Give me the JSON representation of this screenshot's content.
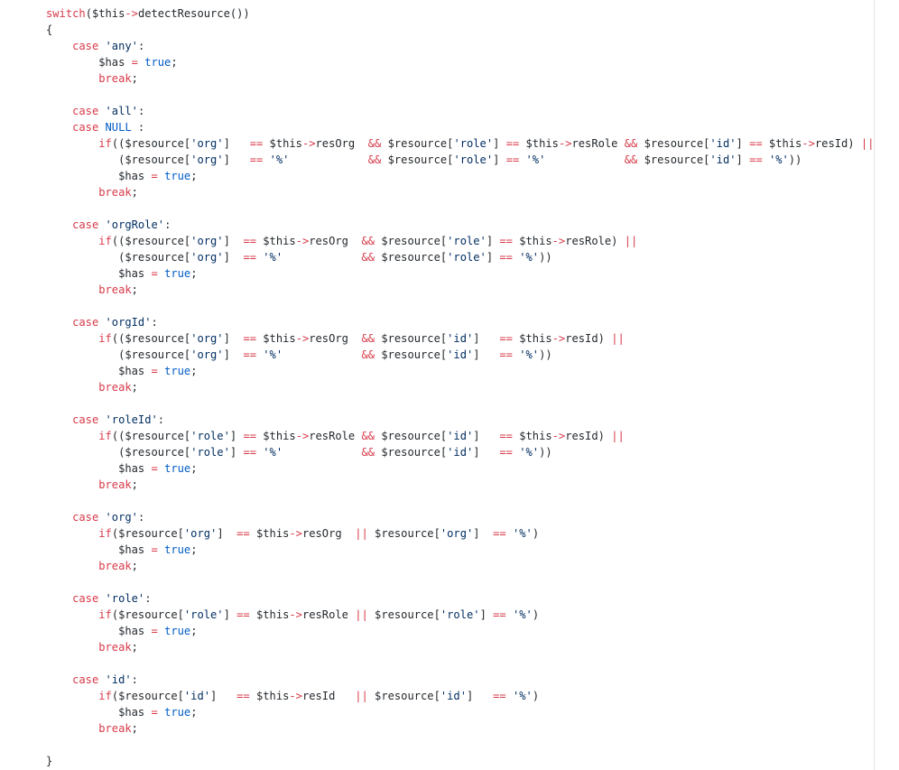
{
  "code_lines": [
    [
      {
        "t": "switch",
        "c": "k"
      },
      {
        "t": "($this",
        "c": "p"
      },
      {
        "t": "->",
        "c": "k"
      },
      {
        "t": "detectResource())",
        "c": "p"
      }
    ],
    [
      {
        "t": "{",
        "c": "p"
      }
    ],
    [
      {
        "t": "    ",
        "c": "p"
      },
      {
        "t": "case",
        "c": "k"
      },
      {
        "t": " ",
        "c": "p"
      },
      {
        "t": "'any'",
        "c": "s"
      },
      {
        "t": ":",
        "c": "p"
      }
    ],
    [
      {
        "t": "        $has ",
        "c": "p"
      },
      {
        "t": "=",
        "c": "k"
      },
      {
        "t": " ",
        "c": "p"
      },
      {
        "t": "true",
        "c": "c"
      },
      {
        "t": ";",
        "c": "p"
      }
    ],
    [
      {
        "t": "        ",
        "c": "p"
      },
      {
        "t": "break",
        "c": "k"
      },
      {
        "t": ";",
        "c": "p"
      }
    ],
    [],
    [
      {
        "t": "    ",
        "c": "p"
      },
      {
        "t": "case",
        "c": "k"
      },
      {
        "t": " ",
        "c": "p"
      },
      {
        "t": "'all'",
        "c": "s"
      },
      {
        "t": ":",
        "c": "p"
      }
    ],
    [
      {
        "t": "    ",
        "c": "p"
      },
      {
        "t": "case",
        "c": "k"
      },
      {
        "t": " ",
        "c": "p"
      },
      {
        "t": "NULL",
        "c": "c"
      },
      {
        "t": " :",
        "c": "p"
      }
    ],
    [
      {
        "t": "        ",
        "c": "p"
      },
      {
        "t": "if",
        "c": "k"
      },
      {
        "t": "(($resource[",
        "c": "p"
      },
      {
        "t": "'org'",
        "c": "s"
      },
      {
        "t": "]   ",
        "c": "p"
      },
      {
        "t": "==",
        "c": "k"
      },
      {
        "t": " $this",
        "c": "p"
      },
      {
        "t": "->",
        "c": "k"
      },
      {
        "t": "resOrg  ",
        "c": "p"
      },
      {
        "t": "&&",
        "c": "k"
      },
      {
        "t": " $resource[",
        "c": "p"
      },
      {
        "t": "'role'",
        "c": "s"
      },
      {
        "t": "] ",
        "c": "p"
      },
      {
        "t": "==",
        "c": "k"
      },
      {
        "t": " $this",
        "c": "p"
      },
      {
        "t": "->",
        "c": "k"
      },
      {
        "t": "resRole ",
        "c": "p"
      },
      {
        "t": "&&",
        "c": "k"
      },
      {
        "t": " $resource[",
        "c": "p"
      },
      {
        "t": "'id'",
        "c": "s"
      },
      {
        "t": "] ",
        "c": "p"
      },
      {
        "t": "==",
        "c": "k"
      },
      {
        "t": " $this",
        "c": "p"
      },
      {
        "t": "->",
        "c": "k"
      },
      {
        "t": "resId) ",
        "c": "p"
      },
      {
        "t": "||",
        "c": "k"
      }
    ],
    [
      {
        "t": "           ($resource[",
        "c": "p"
      },
      {
        "t": "'org'",
        "c": "s"
      },
      {
        "t": "]   ",
        "c": "p"
      },
      {
        "t": "==",
        "c": "k"
      },
      {
        "t": " ",
        "c": "p"
      },
      {
        "t": "'%'",
        "c": "s"
      },
      {
        "t": "            ",
        "c": "p"
      },
      {
        "t": "&&",
        "c": "k"
      },
      {
        "t": " $resource[",
        "c": "p"
      },
      {
        "t": "'role'",
        "c": "s"
      },
      {
        "t": "] ",
        "c": "p"
      },
      {
        "t": "==",
        "c": "k"
      },
      {
        "t": " ",
        "c": "p"
      },
      {
        "t": "'%'",
        "c": "s"
      },
      {
        "t": "            ",
        "c": "p"
      },
      {
        "t": "&&",
        "c": "k"
      },
      {
        "t": " $resource[",
        "c": "p"
      },
      {
        "t": "'id'",
        "c": "s"
      },
      {
        "t": "] ",
        "c": "p"
      },
      {
        "t": "==",
        "c": "k"
      },
      {
        "t": " ",
        "c": "p"
      },
      {
        "t": "'%'",
        "c": "s"
      },
      {
        "t": "))",
        "c": "p"
      }
    ],
    [
      {
        "t": "           $has ",
        "c": "p"
      },
      {
        "t": "=",
        "c": "k"
      },
      {
        "t": " ",
        "c": "p"
      },
      {
        "t": "true",
        "c": "c"
      },
      {
        "t": ";",
        "c": "p"
      }
    ],
    [
      {
        "t": "        ",
        "c": "p"
      },
      {
        "t": "break",
        "c": "k"
      },
      {
        "t": ";",
        "c": "p"
      }
    ],
    [],
    [
      {
        "t": "    ",
        "c": "p"
      },
      {
        "t": "case",
        "c": "k"
      },
      {
        "t": " ",
        "c": "p"
      },
      {
        "t": "'orgRole'",
        "c": "s"
      },
      {
        "t": ":",
        "c": "p"
      }
    ],
    [
      {
        "t": "        ",
        "c": "p"
      },
      {
        "t": "if",
        "c": "k"
      },
      {
        "t": "(($resource[",
        "c": "p"
      },
      {
        "t": "'org'",
        "c": "s"
      },
      {
        "t": "]  ",
        "c": "p"
      },
      {
        "t": "==",
        "c": "k"
      },
      {
        "t": " $this",
        "c": "p"
      },
      {
        "t": "->",
        "c": "k"
      },
      {
        "t": "resOrg  ",
        "c": "p"
      },
      {
        "t": "&&",
        "c": "k"
      },
      {
        "t": " $resource[",
        "c": "p"
      },
      {
        "t": "'role'",
        "c": "s"
      },
      {
        "t": "] ",
        "c": "p"
      },
      {
        "t": "==",
        "c": "k"
      },
      {
        "t": " $this",
        "c": "p"
      },
      {
        "t": "->",
        "c": "k"
      },
      {
        "t": "resRole) ",
        "c": "p"
      },
      {
        "t": "||",
        "c": "k"
      }
    ],
    [
      {
        "t": "           ($resource[",
        "c": "p"
      },
      {
        "t": "'org'",
        "c": "s"
      },
      {
        "t": "]  ",
        "c": "p"
      },
      {
        "t": "==",
        "c": "k"
      },
      {
        "t": " ",
        "c": "p"
      },
      {
        "t": "'%'",
        "c": "s"
      },
      {
        "t": "            ",
        "c": "p"
      },
      {
        "t": "&&",
        "c": "k"
      },
      {
        "t": " $resource[",
        "c": "p"
      },
      {
        "t": "'role'",
        "c": "s"
      },
      {
        "t": "] ",
        "c": "p"
      },
      {
        "t": "==",
        "c": "k"
      },
      {
        "t": " ",
        "c": "p"
      },
      {
        "t": "'%'",
        "c": "s"
      },
      {
        "t": "))",
        "c": "p"
      }
    ],
    [
      {
        "t": "           $has ",
        "c": "p"
      },
      {
        "t": "=",
        "c": "k"
      },
      {
        "t": " ",
        "c": "p"
      },
      {
        "t": "true",
        "c": "c"
      },
      {
        "t": ";",
        "c": "p"
      }
    ],
    [
      {
        "t": "        ",
        "c": "p"
      },
      {
        "t": "break",
        "c": "k"
      },
      {
        "t": ";",
        "c": "p"
      }
    ],
    [],
    [
      {
        "t": "    ",
        "c": "p"
      },
      {
        "t": "case",
        "c": "k"
      },
      {
        "t": " ",
        "c": "p"
      },
      {
        "t": "'orgId'",
        "c": "s"
      },
      {
        "t": ":",
        "c": "p"
      }
    ],
    [
      {
        "t": "        ",
        "c": "p"
      },
      {
        "t": "if",
        "c": "k"
      },
      {
        "t": "(($resource[",
        "c": "p"
      },
      {
        "t": "'org'",
        "c": "s"
      },
      {
        "t": "]  ",
        "c": "p"
      },
      {
        "t": "==",
        "c": "k"
      },
      {
        "t": " $this",
        "c": "p"
      },
      {
        "t": "->",
        "c": "k"
      },
      {
        "t": "resOrg  ",
        "c": "p"
      },
      {
        "t": "&&",
        "c": "k"
      },
      {
        "t": " $resource[",
        "c": "p"
      },
      {
        "t": "'id'",
        "c": "s"
      },
      {
        "t": "]   ",
        "c": "p"
      },
      {
        "t": "==",
        "c": "k"
      },
      {
        "t": " $this",
        "c": "p"
      },
      {
        "t": "->",
        "c": "k"
      },
      {
        "t": "resId) ",
        "c": "p"
      },
      {
        "t": "||",
        "c": "k"
      }
    ],
    [
      {
        "t": "           ($resource[",
        "c": "p"
      },
      {
        "t": "'org'",
        "c": "s"
      },
      {
        "t": "]  ",
        "c": "p"
      },
      {
        "t": "==",
        "c": "k"
      },
      {
        "t": " ",
        "c": "p"
      },
      {
        "t": "'%'",
        "c": "s"
      },
      {
        "t": "            ",
        "c": "p"
      },
      {
        "t": "&&",
        "c": "k"
      },
      {
        "t": " $resource[",
        "c": "p"
      },
      {
        "t": "'id'",
        "c": "s"
      },
      {
        "t": "]   ",
        "c": "p"
      },
      {
        "t": "==",
        "c": "k"
      },
      {
        "t": " ",
        "c": "p"
      },
      {
        "t": "'%'",
        "c": "s"
      },
      {
        "t": "))",
        "c": "p"
      }
    ],
    [
      {
        "t": "           $has ",
        "c": "p"
      },
      {
        "t": "=",
        "c": "k"
      },
      {
        "t": " ",
        "c": "p"
      },
      {
        "t": "true",
        "c": "c"
      },
      {
        "t": ";",
        "c": "p"
      }
    ],
    [
      {
        "t": "        ",
        "c": "p"
      },
      {
        "t": "break",
        "c": "k"
      },
      {
        "t": ";",
        "c": "p"
      }
    ],
    [],
    [
      {
        "t": "    ",
        "c": "p"
      },
      {
        "t": "case",
        "c": "k"
      },
      {
        "t": " ",
        "c": "p"
      },
      {
        "t": "'roleId'",
        "c": "s"
      },
      {
        "t": ":",
        "c": "p"
      }
    ],
    [
      {
        "t": "        ",
        "c": "p"
      },
      {
        "t": "if",
        "c": "k"
      },
      {
        "t": "(($resource[",
        "c": "p"
      },
      {
        "t": "'role'",
        "c": "s"
      },
      {
        "t": "] ",
        "c": "p"
      },
      {
        "t": "==",
        "c": "k"
      },
      {
        "t": " $this",
        "c": "p"
      },
      {
        "t": "->",
        "c": "k"
      },
      {
        "t": "resRole ",
        "c": "p"
      },
      {
        "t": "&&",
        "c": "k"
      },
      {
        "t": " $resource[",
        "c": "p"
      },
      {
        "t": "'id'",
        "c": "s"
      },
      {
        "t": "]   ",
        "c": "p"
      },
      {
        "t": "==",
        "c": "k"
      },
      {
        "t": " $this",
        "c": "p"
      },
      {
        "t": "->",
        "c": "k"
      },
      {
        "t": "resId) ",
        "c": "p"
      },
      {
        "t": "||",
        "c": "k"
      }
    ],
    [
      {
        "t": "           ($resource[",
        "c": "p"
      },
      {
        "t": "'role'",
        "c": "s"
      },
      {
        "t": "] ",
        "c": "p"
      },
      {
        "t": "==",
        "c": "k"
      },
      {
        "t": " ",
        "c": "p"
      },
      {
        "t": "'%'",
        "c": "s"
      },
      {
        "t": "            ",
        "c": "p"
      },
      {
        "t": "&&",
        "c": "k"
      },
      {
        "t": " $resource[",
        "c": "p"
      },
      {
        "t": "'id'",
        "c": "s"
      },
      {
        "t": "]   ",
        "c": "p"
      },
      {
        "t": "==",
        "c": "k"
      },
      {
        "t": " ",
        "c": "p"
      },
      {
        "t": "'%'",
        "c": "s"
      },
      {
        "t": "))",
        "c": "p"
      }
    ],
    [
      {
        "t": "           $has ",
        "c": "p"
      },
      {
        "t": "=",
        "c": "k"
      },
      {
        "t": " ",
        "c": "p"
      },
      {
        "t": "true",
        "c": "c"
      },
      {
        "t": ";",
        "c": "p"
      }
    ],
    [
      {
        "t": "        ",
        "c": "p"
      },
      {
        "t": "break",
        "c": "k"
      },
      {
        "t": ";",
        "c": "p"
      }
    ],
    [],
    [
      {
        "t": "    ",
        "c": "p"
      },
      {
        "t": "case",
        "c": "k"
      },
      {
        "t": " ",
        "c": "p"
      },
      {
        "t": "'org'",
        "c": "s"
      },
      {
        "t": ":",
        "c": "p"
      }
    ],
    [
      {
        "t": "        ",
        "c": "p"
      },
      {
        "t": "if",
        "c": "k"
      },
      {
        "t": "($resource[",
        "c": "p"
      },
      {
        "t": "'org'",
        "c": "s"
      },
      {
        "t": "]  ",
        "c": "p"
      },
      {
        "t": "==",
        "c": "k"
      },
      {
        "t": " $this",
        "c": "p"
      },
      {
        "t": "->",
        "c": "k"
      },
      {
        "t": "resOrg  ",
        "c": "p"
      },
      {
        "t": "||",
        "c": "k"
      },
      {
        "t": " $resource[",
        "c": "p"
      },
      {
        "t": "'org'",
        "c": "s"
      },
      {
        "t": "]  ",
        "c": "p"
      },
      {
        "t": "==",
        "c": "k"
      },
      {
        "t": " ",
        "c": "p"
      },
      {
        "t": "'%'",
        "c": "s"
      },
      {
        "t": ")",
        "c": "p"
      }
    ],
    [
      {
        "t": "           $has ",
        "c": "p"
      },
      {
        "t": "=",
        "c": "k"
      },
      {
        "t": " ",
        "c": "p"
      },
      {
        "t": "true",
        "c": "c"
      },
      {
        "t": ";",
        "c": "p"
      }
    ],
    [
      {
        "t": "        ",
        "c": "p"
      },
      {
        "t": "break",
        "c": "k"
      },
      {
        "t": ";",
        "c": "p"
      }
    ],
    [],
    [
      {
        "t": "    ",
        "c": "p"
      },
      {
        "t": "case",
        "c": "k"
      },
      {
        "t": " ",
        "c": "p"
      },
      {
        "t": "'role'",
        "c": "s"
      },
      {
        "t": ":",
        "c": "p"
      }
    ],
    [
      {
        "t": "        ",
        "c": "p"
      },
      {
        "t": "if",
        "c": "k"
      },
      {
        "t": "($resource[",
        "c": "p"
      },
      {
        "t": "'role'",
        "c": "s"
      },
      {
        "t": "] ",
        "c": "p"
      },
      {
        "t": "==",
        "c": "k"
      },
      {
        "t": " $this",
        "c": "p"
      },
      {
        "t": "->",
        "c": "k"
      },
      {
        "t": "resRole ",
        "c": "p"
      },
      {
        "t": "||",
        "c": "k"
      },
      {
        "t": " $resource[",
        "c": "p"
      },
      {
        "t": "'role'",
        "c": "s"
      },
      {
        "t": "] ",
        "c": "p"
      },
      {
        "t": "==",
        "c": "k"
      },
      {
        "t": " ",
        "c": "p"
      },
      {
        "t": "'%'",
        "c": "s"
      },
      {
        "t": ")",
        "c": "p"
      }
    ],
    [
      {
        "t": "           $has ",
        "c": "p"
      },
      {
        "t": "=",
        "c": "k"
      },
      {
        "t": " ",
        "c": "p"
      },
      {
        "t": "true",
        "c": "c"
      },
      {
        "t": ";",
        "c": "p"
      }
    ],
    [
      {
        "t": "        ",
        "c": "p"
      },
      {
        "t": "break",
        "c": "k"
      },
      {
        "t": ";",
        "c": "p"
      }
    ],
    [],
    [
      {
        "t": "    ",
        "c": "p"
      },
      {
        "t": "case",
        "c": "k"
      },
      {
        "t": " ",
        "c": "p"
      },
      {
        "t": "'id'",
        "c": "s"
      },
      {
        "t": ":",
        "c": "p"
      }
    ],
    [
      {
        "t": "        ",
        "c": "p"
      },
      {
        "t": "if",
        "c": "k"
      },
      {
        "t": "($resource[",
        "c": "p"
      },
      {
        "t": "'id'",
        "c": "s"
      },
      {
        "t": "]   ",
        "c": "p"
      },
      {
        "t": "==",
        "c": "k"
      },
      {
        "t": " $this",
        "c": "p"
      },
      {
        "t": "->",
        "c": "k"
      },
      {
        "t": "resId   ",
        "c": "p"
      },
      {
        "t": "||",
        "c": "k"
      },
      {
        "t": " $resource[",
        "c": "p"
      },
      {
        "t": "'id'",
        "c": "s"
      },
      {
        "t": "]   ",
        "c": "p"
      },
      {
        "t": "==",
        "c": "k"
      },
      {
        "t": " ",
        "c": "p"
      },
      {
        "t": "'%'",
        "c": "s"
      },
      {
        "t": ")",
        "c": "p"
      }
    ],
    [
      {
        "t": "           $has ",
        "c": "p"
      },
      {
        "t": "=",
        "c": "k"
      },
      {
        "t": " ",
        "c": "p"
      },
      {
        "t": "true",
        "c": "c"
      },
      {
        "t": ";",
        "c": "p"
      }
    ],
    [
      {
        "t": "        ",
        "c": "p"
      },
      {
        "t": "break",
        "c": "k"
      },
      {
        "t": ";",
        "c": "p"
      }
    ],
    [],
    [
      {
        "t": "}",
        "c": "p"
      }
    ]
  ],
  "colors": {
    "keyword": "#d73a49",
    "string": "#032f62",
    "constant": "#005cc5",
    "plain": "#24292e",
    "background": "#ffffff",
    "scrollbar_line": "#e1e4e8"
  }
}
